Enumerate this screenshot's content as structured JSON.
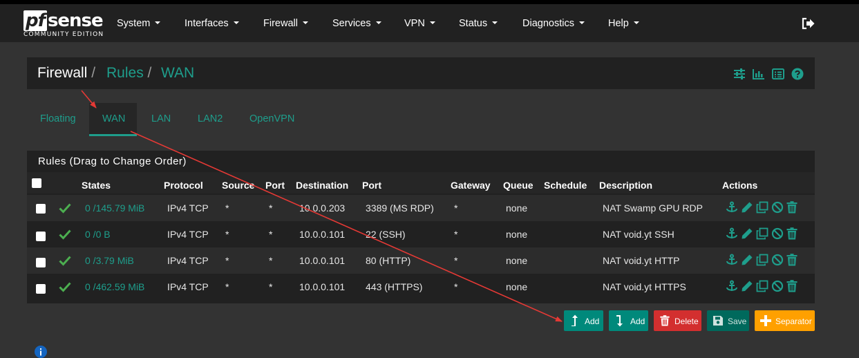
{
  "brand": {
    "logo": "pfsense",
    "logo_prefix": "pf",
    "logo_suffix": "sense",
    "edition": "COMMUNITY EDITION"
  },
  "nav": {
    "items": [
      {
        "label": "System"
      },
      {
        "label": "Interfaces"
      },
      {
        "label": "Firewall"
      },
      {
        "label": "Services"
      },
      {
        "label": "VPN"
      },
      {
        "label": "Status"
      },
      {
        "label": "Diagnostics"
      },
      {
        "label": "Help"
      }
    ],
    "logout_icon": "sign-out-icon"
  },
  "breadcrumb": {
    "root": "Firewall",
    "section": "Rules",
    "current": "WAN",
    "separator": "/"
  },
  "header_icons": [
    "sliders-icon",
    "bar-chart-icon",
    "list-alt-icon",
    "question-circle-icon"
  ],
  "tabs": [
    {
      "label": "Floating",
      "active": false
    },
    {
      "label": "WAN",
      "active": true
    },
    {
      "label": "LAN",
      "active": false
    },
    {
      "label": "LAN2",
      "active": false
    },
    {
      "label": "OpenVPN",
      "active": false
    }
  ],
  "rules_panel": {
    "heading": "Rules (Drag to Change Order)",
    "columns": [
      "States",
      "Protocol",
      "Source",
      "Port",
      "Destination",
      "Port",
      "Gateway",
      "Queue",
      "Schedule",
      "Description",
      "Actions"
    ],
    "rows": [
      {
        "states": "0 /145.79 MiB",
        "protocol": "IPv4 TCP",
        "source": "*",
        "src_port": "*",
        "destination": "10.0.0.203",
        "dst_port": "3389 (MS RDP)",
        "gateway": "*",
        "queue": "none",
        "schedule": "",
        "description": "NAT Swamp GPU RDP"
      },
      {
        "states": "0 /0 B",
        "protocol": "IPv4 TCP",
        "source": "*",
        "src_port": "*",
        "destination": "10.0.0.101",
        "dst_port": "22 (SSH)",
        "gateway": "*",
        "queue": "none",
        "schedule": "",
        "description": "NAT void.yt SSH"
      },
      {
        "states": "0 /3.79 MiB",
        "protocol": "IPv4 TCP",
        "source": "*",
        "src_port": "*",
        "destination": "10.0.0.101",
        "dst_port": "80 (HTTP)",
        "gateway": "*",
        "queue": "none",
        "schedule": "",
        "description": "NAT void.yt HTTP"
      },
      {
        "states": "0 /462.59 MiB",
        "protocol": "IPv4 TCP",
        "source": "*",
        "src_port": "*",
        "destination": "10.0.0.101",
        "dst_port": "443 (HTTPS)",
        "gateway": "*",
        "queue": "none",
        "schedule": "",
        "description": "NAT void.yt HTTPS"
      }
    ],
    "action_icons": [
      "anchor-icon",
      "pencil-icon",
      "copy-icon",
      "ban-icon",
      "trash-icon"
    ]
  },
  "buttons": {
    "add_top": "Add",
    "add_bottom": "Add",
    "delete": "Delete",
    "save": "Save",
    "separator": "Separator"
  },
  "colors": {
    "accent": "#1e9e8c",
    "navbar": "#212121",
    "background": "#333333",
    "check": "#4caf50",
    "delete": "#d32f2f",
    "separator": "#ffa000",
    "annotation_arrow": "#e53935"
  }
}
